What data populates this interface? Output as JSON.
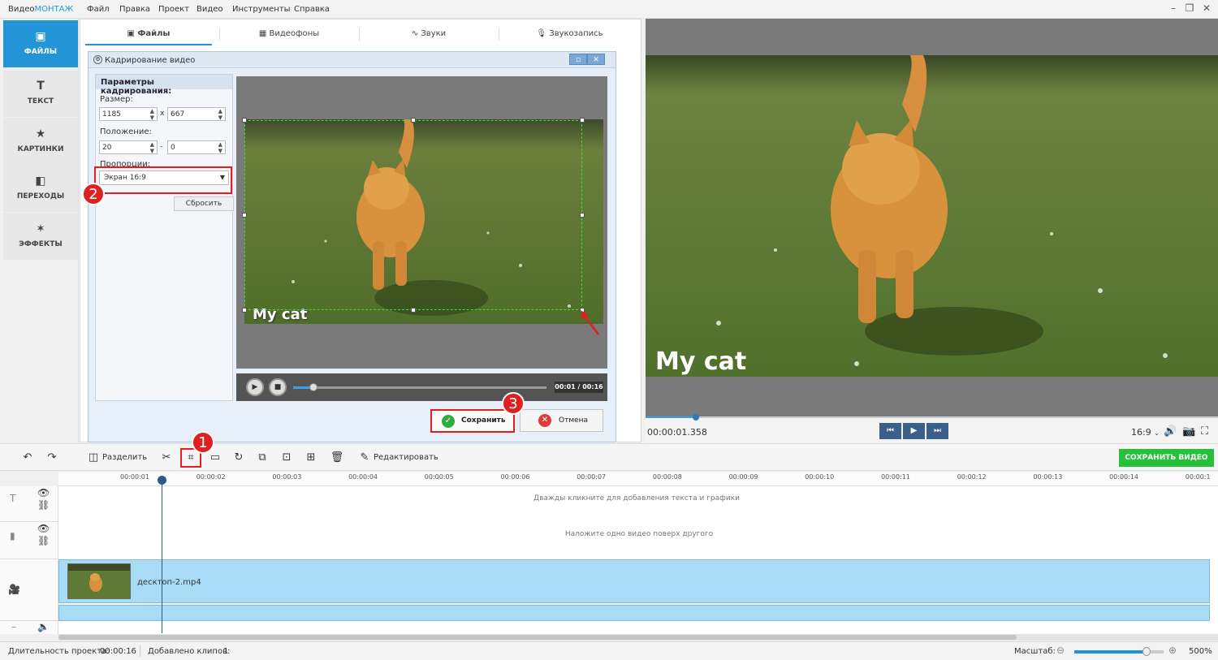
{
  "app": {
    "logo_a": "Видео",
    "logo_b": "МОНТАЖ",
    "menu": [
      "Файл",
      "Правка",
      "Проект",
      "Видео",
      "Инструменты",
      "Справка"
    ],
    "window_controls": [
      "minimize-icon",
      "restore-icon",
      "close-icon"
    ]
  },
  "sidebar": {
    "items": [
      {
        "label": "ФАЙЛЫ",
        "icon": "image-icon",
        "active": true
      },
      {
        "label": "ТЕКСТ",
        "icon": "text-icon",
        "active": false
      },
      {
        "label": "КАРТИНКИ",
        "icon": "star-icon",
        "active": false
      },
      {
        "label": "ПЕРЕХОДЫ",
        "icon": "transition-icon",
        "active": false
      },
      {
        "label": "ЭФФЕКТЫ",
        "icon": "magic-wand-icon",
        "active": false
      }
    ]
  },
  "tabs": [
    {
      "label": "Файлы",
      "icon": "image-icon",
      "active": true
    },
    {
      "label": "Видеофоны",
      "icon": "film-icon",
      "active": false
    },
    {
      "label": "Звуки",
      "icon": "waveform-icon",
      "active": false
    },
    {
      "label": "Звукозапись",
      "icon": "microphone-icon",
      "active": false
    }
  ],
  "dialog": {
    "title": "Кадрирование видео",
    "params_header": "Параметры кадрирования:",
    "size_label": "Размер:",
    "width": "1185",
    "height": "667",
    "x_sep": "x",
    "position_label": "Положение:",
    "pos_x": "20",
    "pos_y": "0",
    "pos_sep": "-",
    "ratio_label": "Пропорции:",
    "ratio_value": "Экран 16:9",
    "reset_label": "Сбросить",
    "player_time": "00:01 / 00:16",
    "overlay_text": "My cat",
    "save_label": "Сохранить",
    "cancel_label": "Отмена",
    "progress_fraction": 0.08
  },
  "preview": {
    "overlay_text": "My cat",
    "time": "00:00:01.358",
    "ratio": "16:9",
    "progress_fraction": 0.088
  },
  "toolbar": {
    "split_label": "Разделить",
    "edit_label": "Редактировать",
    "save_video_label": "СОХРАНИТЬ ВИДЕО"
  },
  "ruler": {
    "ticks": [
      "00:00:01",
      "00:00:02",
      "00:00:03",
      "00:00:04",
      "00:00:05",
      "00:00:06",
      "00:00:07",
      "00:00:08",
      "00:00:09",
      "00:00:10",
      "00:00:11",
      "00:00:12",
      "00:00:13",
      "00:00:14",
      "00:00:1"
    ]
  },
  "timeline": {
    "text_hint": "Дважды кликните для добавления текста и графики",
    "overlay_hint": "Наложите одно видео поверх другого",
    "clip_name": "десктоп-2.mp4"
  },
  "status": {
    "duration_label": "Длительность проекта:",
    "duration": "00:00:16",
    "clips_label": "Добавлено клипов:",
    "clips": "1",
    "zoom_label": "Масштаб:",
    "zoom_value": "500%"
  },
  "callouts": [
    "1",
    "2",
    "3"
  ],
  "colors": {
    "accent": "#2395d6",
    "highlight": "#e02020",
    "save_video": "#27c03a"
  }
}
